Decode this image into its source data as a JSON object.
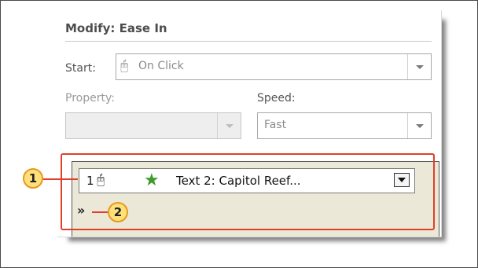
{
  "pane": {
    "title": "Modify: Ease In",
    "start_label": "Start:",
    "start_value": "On Click",
    "start_icon": "mouse-click-icon",
    "property_label": "Property:",
    "property_value": "",
    "speed_label": "Speed:",
    "speed_value": "Fast"
  },
  "animation_list": {
    "items": [
      {
        "number": "1",
        "trigger_icon": "mouse-click-icon",
        "effect_icon": "green-star-icon",
        "text": "Text 2: Capitol Reef..."
      }
    ],
    "expand_icon": "double-chevron-down-icon"
  },
  "callouts": [
    {
      "label": "1"
    },
    {
      "label": "2"
    }
  ],
  "colors": {
    "highlight": "#e0402a",
    "callout_fill": "#ffe07a",
    "list_background": "#ebe8d8",
    "effect_star": "#3e9a2c"
  }
}
